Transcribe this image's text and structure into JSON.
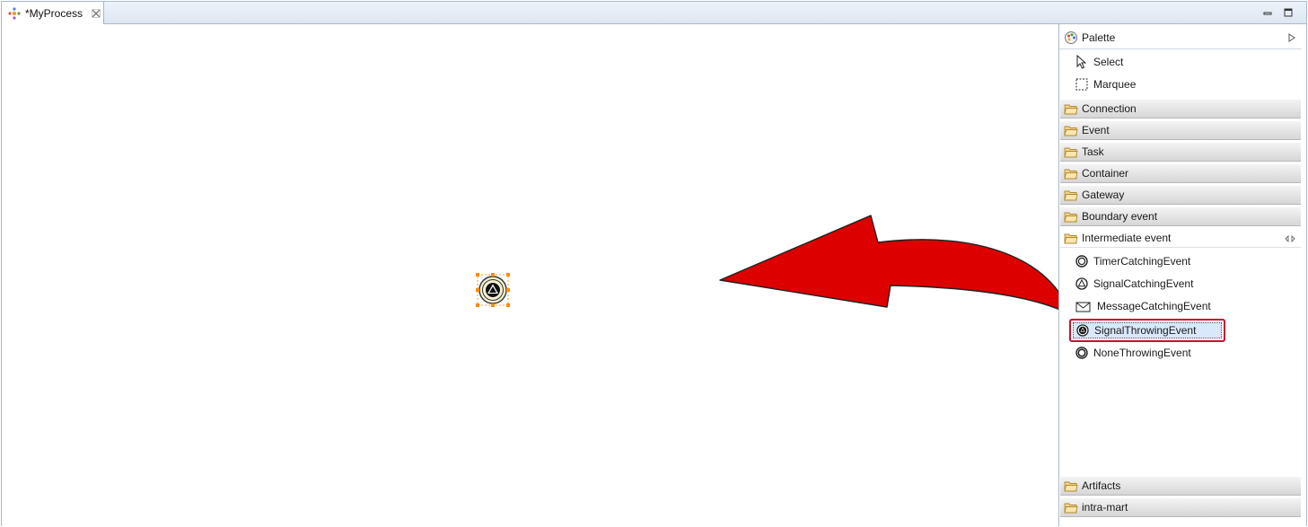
{
  "editor": {
    "tab_title": "*MyProcess"
  },
  "palette": {
    "title": "Palette",
    "tools": [
      {
        "label": "Select"
      },
      {
        "label": "Marquee"
      }
    ],
    "drawers": [
      {
        "label": "Connection"
      },
      {
        "label": "Event"
      },
      {
        "label": "Task"
      },
      {
        "label": "Container"
      },
      {
        "label": "Gateway"
      },
      {
        "label": "Boundary event"
      },
      {
        "label": "Intermediate event"
      }
    ],
    "intermediate_entries": [
      {
        "label": "TimerCatchingEvent"
      },
      {
        "label": "SignalCatchingEvent"
      },
      {
        "label": "MessageCatchingEvent"
      },
      {
        "label": "SignalThrowingEvent"
      },
      {
        "label": "NoneThrowingEvent"
      }
    ],
    "bottom_drawers": [
      {
        "label": "Artifacts"
      },
      {
        "label": "intra-mart"
      }
    ],
    "selected_entry": "SignalThrowingEvent"
  },
  "colors": {
    "highlight_border": "#c8102e",
    "arrow_fill": "#dd0000",
    "selection_handle": "#ff8c00"
  }
}
